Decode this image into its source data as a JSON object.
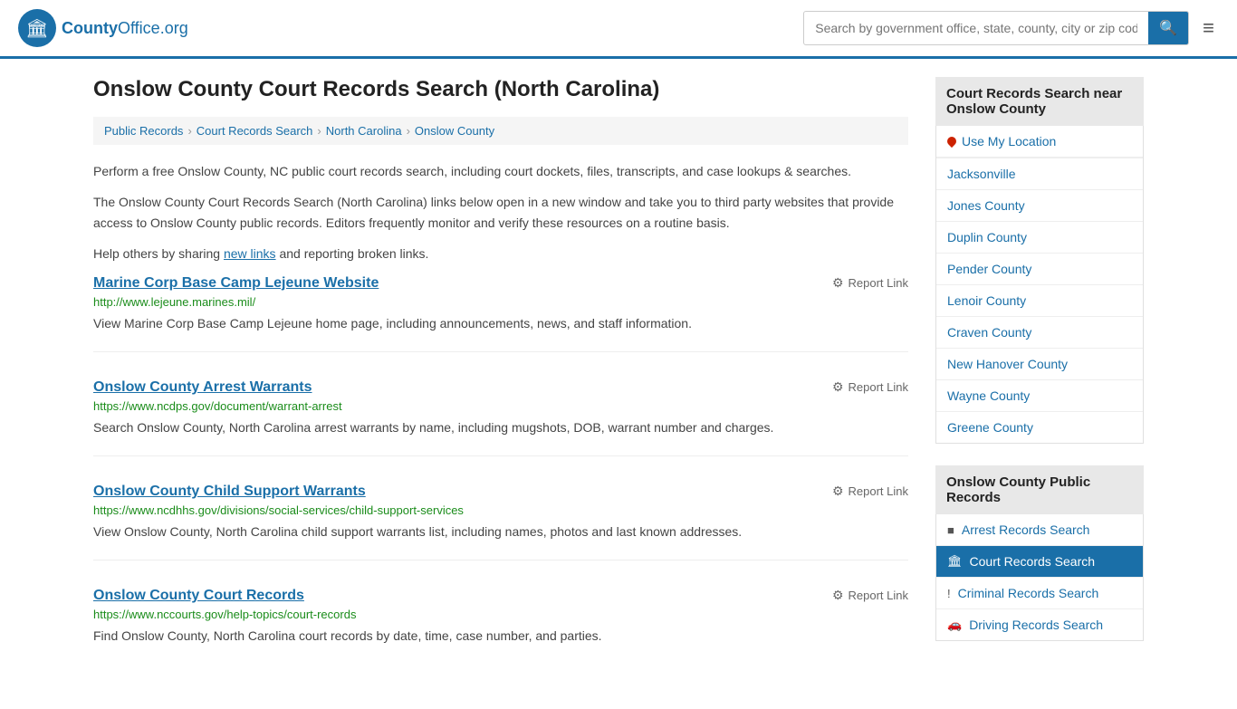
{
  "header": {
    "logo_text": "County",
    "logo_org": "Office",
    "logo_tld": ".org",
    "search_placeholder": "Search by government office, state, county, city or zip code",
    "search_icon": "🔍",
    "menu_icon": "≡"
  },
  "page": {
    "title": "Onslow County Court Records Search (North Carolina)",
    "breadcrumbs": [
      {
        "label": "Public Records",
        "href": "#"
      },
      {
        "label": "Court Records Search",
        "href": "#"
      },
      {
        "label": "North Carolina",
        "href": "#"
      },
      {
        "label": "Onslow County",
        "href": "#"
      }
    ],
    "description1": "Perform a free Onslow County, NC public court records search, including court dockets, files, transcripts, and case lookups & searches.",
    "description2": "The Onslow County Court Records Search (North Carolina) links below open in a new window and take you to third party websites that provide access to Onslow County public records. Editors frequently monitor and verify these resources on a routine basis.",
    "description3_prefix": "Help others by sharing ",
    "description3_link": "new links",
    "description3_suffix": " and reporting broken links."
  },
  "results": [
    {
      "title": "Marine Corp Base Camp Lejeune Website",
      "url": "http://www.lejeune.marines.mil/",
      "description": "View Marine Corp Base Camp Lejeune home page, including announcements, news, and staff information.",
      "report_label": "Report Link"
    },
    {
      "title": "Onslow County Arrest Warrants",
      "url": "https://www.ncdps.gov/document/warrant-arrest",
      "description": "Search Onslow County, North Carolina arrest warrants by name, including mugshots, DOB, warrant number and charges.",
      "report_label": "Report Link"
    },
    {
      "title": "Onslow County Child Support Warrants",
      "url": "https://www.ncdhhs.gov/divisions/social-services/child-support-services",
      "description": "View Onslow County, North Carolina child support warrants list, including names, photos and last known addresses.",
      "report_label": "Report Link"
    },
    {
      "title": "Onslow County Court Records",
      "url": "https://www.nccourts.gov/help-topics/court-records",
      "description": "Find Onslow County, North Carolina court records by date, time, case number, and parties.",
      "report_label": "Report Link"
    }
  ],
  "sidebar": {
    "nearby_title": "Court Records Search near Onslow County",
    "use_location_label": "Use My Location",
    "nearby_links": [
      {
        "label": "Jacksonville"
      },
      {
        "label": "Jones County"
      },
      {
        "label": "Duplin County"
      },
      {
        "label": "Pender County"
      },
      {
        "label": "Lenoir County"
      },
      {
        "label": "Craven County"
      },
      {
        "label": "New Hanover County"
      },
      {
        "label": "Wayne County"
      },
      {
        "label": "Greene County"
      }
    ],
    "public_records_title": "Onslow County Public Records",
    "public_records_links": [
      {
        "label": "Arrest Records Search",
        "icon": "■",
        "active": false
      },
      {
        "label": "Court Records Search",
        "icon": "🏛",
        "active": true
      },
      {
        "label": "Criminal Records Search",
        "icon": "!",
        "active": false
      },
      {
        "label": "Driving Records Search",
        "icon": "🚗",
        "active": false
      }
    ]
  }
}
